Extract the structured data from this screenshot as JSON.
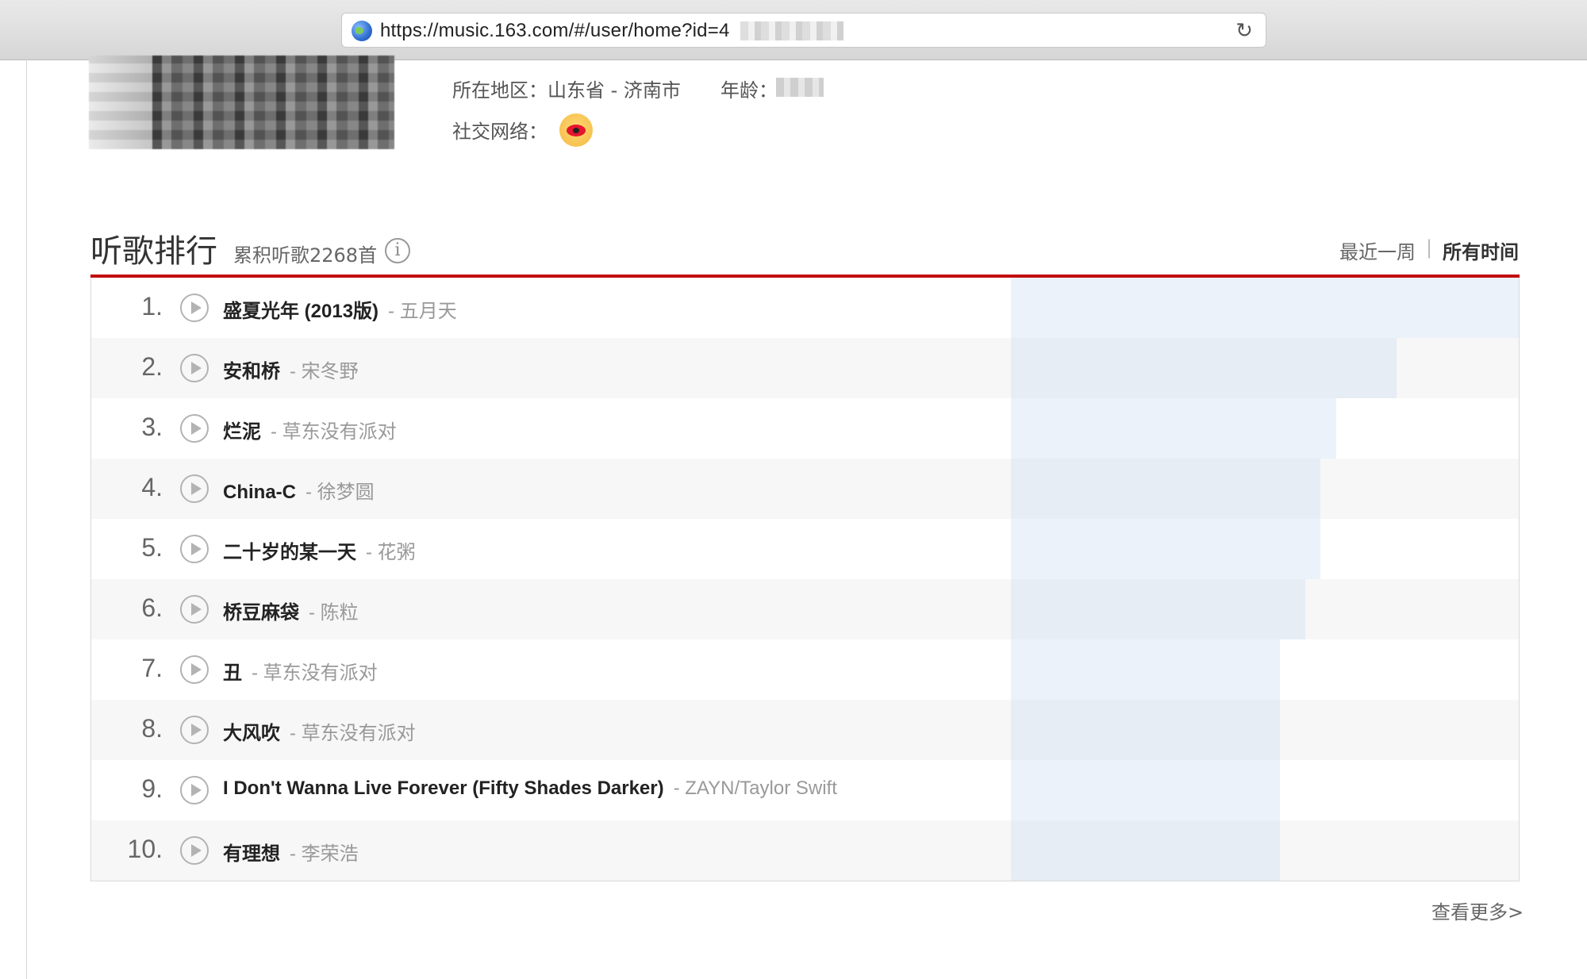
{
  "browser": {
    "url": "https://music.163.com/#/user/home?id=4",
    "reload_icon": "reload-icon"
  },
  "profile": {
    "region_label": "所在地区：",
    "region_value": "山东省 - 济南市",
    "age_label": "年龄：",
    "social_label": "社交网络：",
    "social_icon": "weibo-icon"
  },
  "ranking": {
    "title": "听歌排行",
    "subtitle": "累积听歌2268首",
    "info_icon": "i",
    "period_week": "最近一周",
    "period_separator": "|",
    "period_all": "所有时间",
    "more_link": "查看更多>",
    "songs": [
      {
        "rank": "1.",
        "name": "盛夏光年 (2013版)",
        "artist": "- 五月天",
        "play_share": 1.0
      },
      {
        "rank": "2.",
        "name": "安和桥",
        "artist": "- 宋冬野",
        "play_share": 0.76
      },
      {
        "rank": "3.",
        "name": "烂泥",
        "artist": "- 草东没有派对",
        "play_share": 0.64
      },
      {
        "rank": "4.",
        "name": "China-C",
        "artist": "- 徐梦圆",
        "play_share": 0.61
      },
      {
        "rank": "5.",
        "name": "二十岁的某一天",
        "artist": "- 花粥",
        "play_share": 0.61
      },
      {
        "rank": "6.",
        "name": "桥豆麻袋",
        "artist": "- 陈粒",
        "play_share": 0.58
      },
      {
        "rank": "7.",
        "name": "丑",
        "artist": "- 草东没有派对",
        "play_share": 0.53
      },
      {
        "rank": "8.",
        "name": "大风吹",
        "artist": "- 草东没有派对",
        "play_share": 0.53
      },
      {
        "rank": "9.",
        "name": "I Don't Wanna Live Forever (Fifty Shades Darker)",
        "artist": "- ZAYN/Taylor Swift",
        "play_share": 0.53
      },
      {
        "rank": "10.",
        "name": "有理想",
        "artist": "- 李荣浩",
        "play_share": 0.53
      }
    ]
  }
}
